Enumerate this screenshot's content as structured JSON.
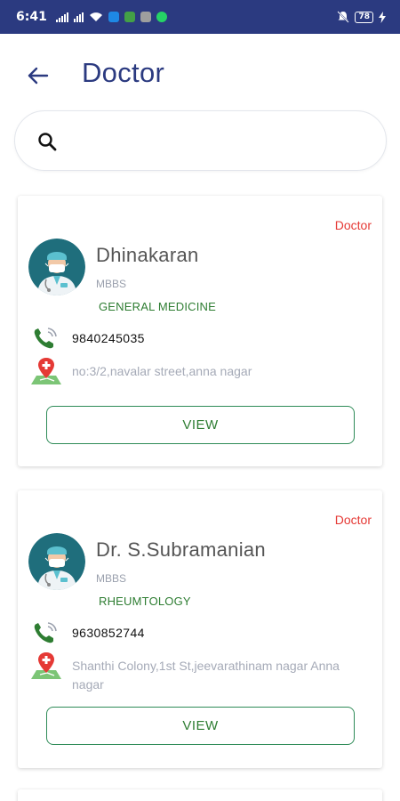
{
  "status_bar": {
    "time": "6:41",
    "battery": "78",
    "accent": "#2b3a80"
  },
  "header": {
    "title": "Doctor",
    "back_icon": "arrow-left-icon"
  },
  "search": {
    "placeholder": "",
    "value": "",
    "icon": "search-icon"
  },
  "doctors": [
    {
      "role": "Doctor",
      "name": "Dhinakaran",
      "degree": "MBBS",
      "specialty": "GENERAL MEDICINE",
      "phone": "9840245035",
      "address": "no:3/2,navalar street,anna nagar",
      "view_label": "VIEW"
    },
    {
      "role": "Doctor",
      "name": "Dr. S.Subramanian",
      "degree": "MBBS",
      "specialty": "RHEUMTOLOGY",
      "phone": "9630852744",
      "address": "Shanthi Colony,1st St,jeevarathinam nagar Anna nagar",
      "view_label": "VIEW"
    }
  ],
  "colors": {
    "primary": "#2b3a80",
    "role_tag": "#e53935",
    "specialty": "#2e7d32",
    "button_border": "#2e8b57"
  }
}
